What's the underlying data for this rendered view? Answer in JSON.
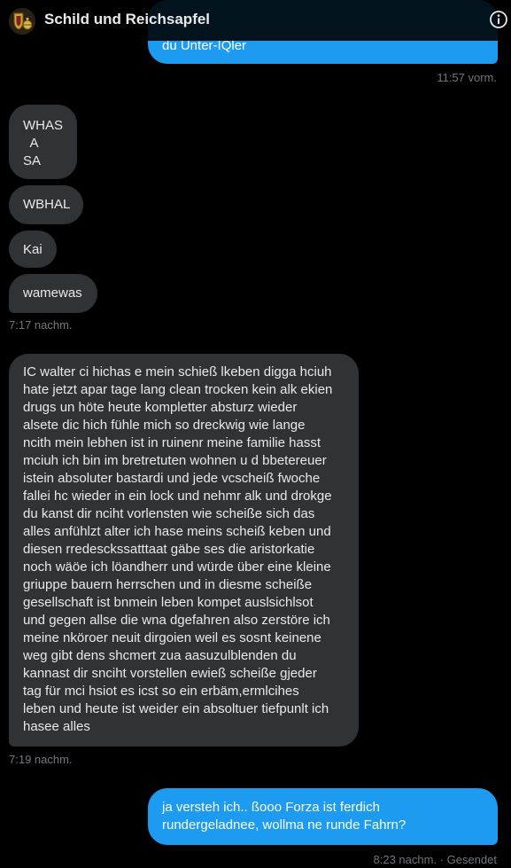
{
  "header": {
    "title": "Schild und Reichsapfel",
    "avatar_icon": "shield-and-orb-avatar",
    "info_icon": "info-icon"
  },
  "messages": [
    {
      "direction": "sent",
      "text": "du Unter-IQler"
    },
    {
      "direction": "meta",
      "text": "11:57 vorm."
    },
    {
      "direction": "received",
      "lines": [
        "WHAS",
        "  A",
        "SA"
      ]
    },
    {
      "direction": "received",
      "text": "WBHAL"
    },
    {
      "direction": "received",
      "text": "Kai"
    },
    {
      "direction": "received",
      "text": "wamewas"
    },
    {
      "direction": "meta",
      "text": "7:17 nachm."
    },
    {
      "direction": "received",
      "lines": [
        "IC walter ci hichas e mein schieß lkeben digga hciuh",
        "hate jetzt apar tage lang clean trocken kein alk ekien",
        "drugs un höte heute kompletter absturz wieder",
        "alsete dic hich fühle mich so dreckwig wie lange",
        "ncith mein lebhen ist in ruinenr meine familie hasst",
        "mciuh ich bin im bretretuten wohnen u d bbetereuer",
        "istein absoluter bastardi und jede vcscheiß fwoche",
        "fallei hc wieder in ein lock und nehmr alk und drokge",
        "du kanst dir nciht vorlensten wie scheiße sich das",
        "alles anfühlzt alter ich hase meins scheiß keben und",
        "diesen rredesckssatttaat gäbe ses die aristorkatie",
        "noch wäöe ich löandherr und würde über eine kleine",
        "griuppe bauern herrschen und in diesme scheiße",
        "gesellschaft ist bnmein leben kompet auslsichlsot",
        "und gegen allse die wna dgefahren also zerstöre ich",
        "meine nköroer neuit dirgoien weil es sosnt keinene",
        "weg gibt dens shcmert zua aasuzulblenden du",
        "kannast dir snciht vorstellen ewieß scheiße gjeder",
        "tag für mci hsiot es icst so ein erbäm,ermlcihes",
        "leben und heute ist weider ein absoltuer tiefpunlt ich",
        "hasee alles"
      ]
    },
    {
      "direction": "meta",
      "text": "7:19 nachm."
    },
    {
      "direction": "sent",
      "lines": [
        "ja versteh ich.. ßooo Forza ist ferdich",
        "rundergeladnee, wollma ne runde Fahrn?"
      ]
    },
    {
      "direction": "meta",
      "text": "8:23 nachm. · Gesendet"
    }
  ],
  "colors": {
    "background": "#000000",
    "sent_bubble": "#1d9bf0",
    "received_bubble": "#2f3336",
    "timestamp": "#71767b"
  }
}
